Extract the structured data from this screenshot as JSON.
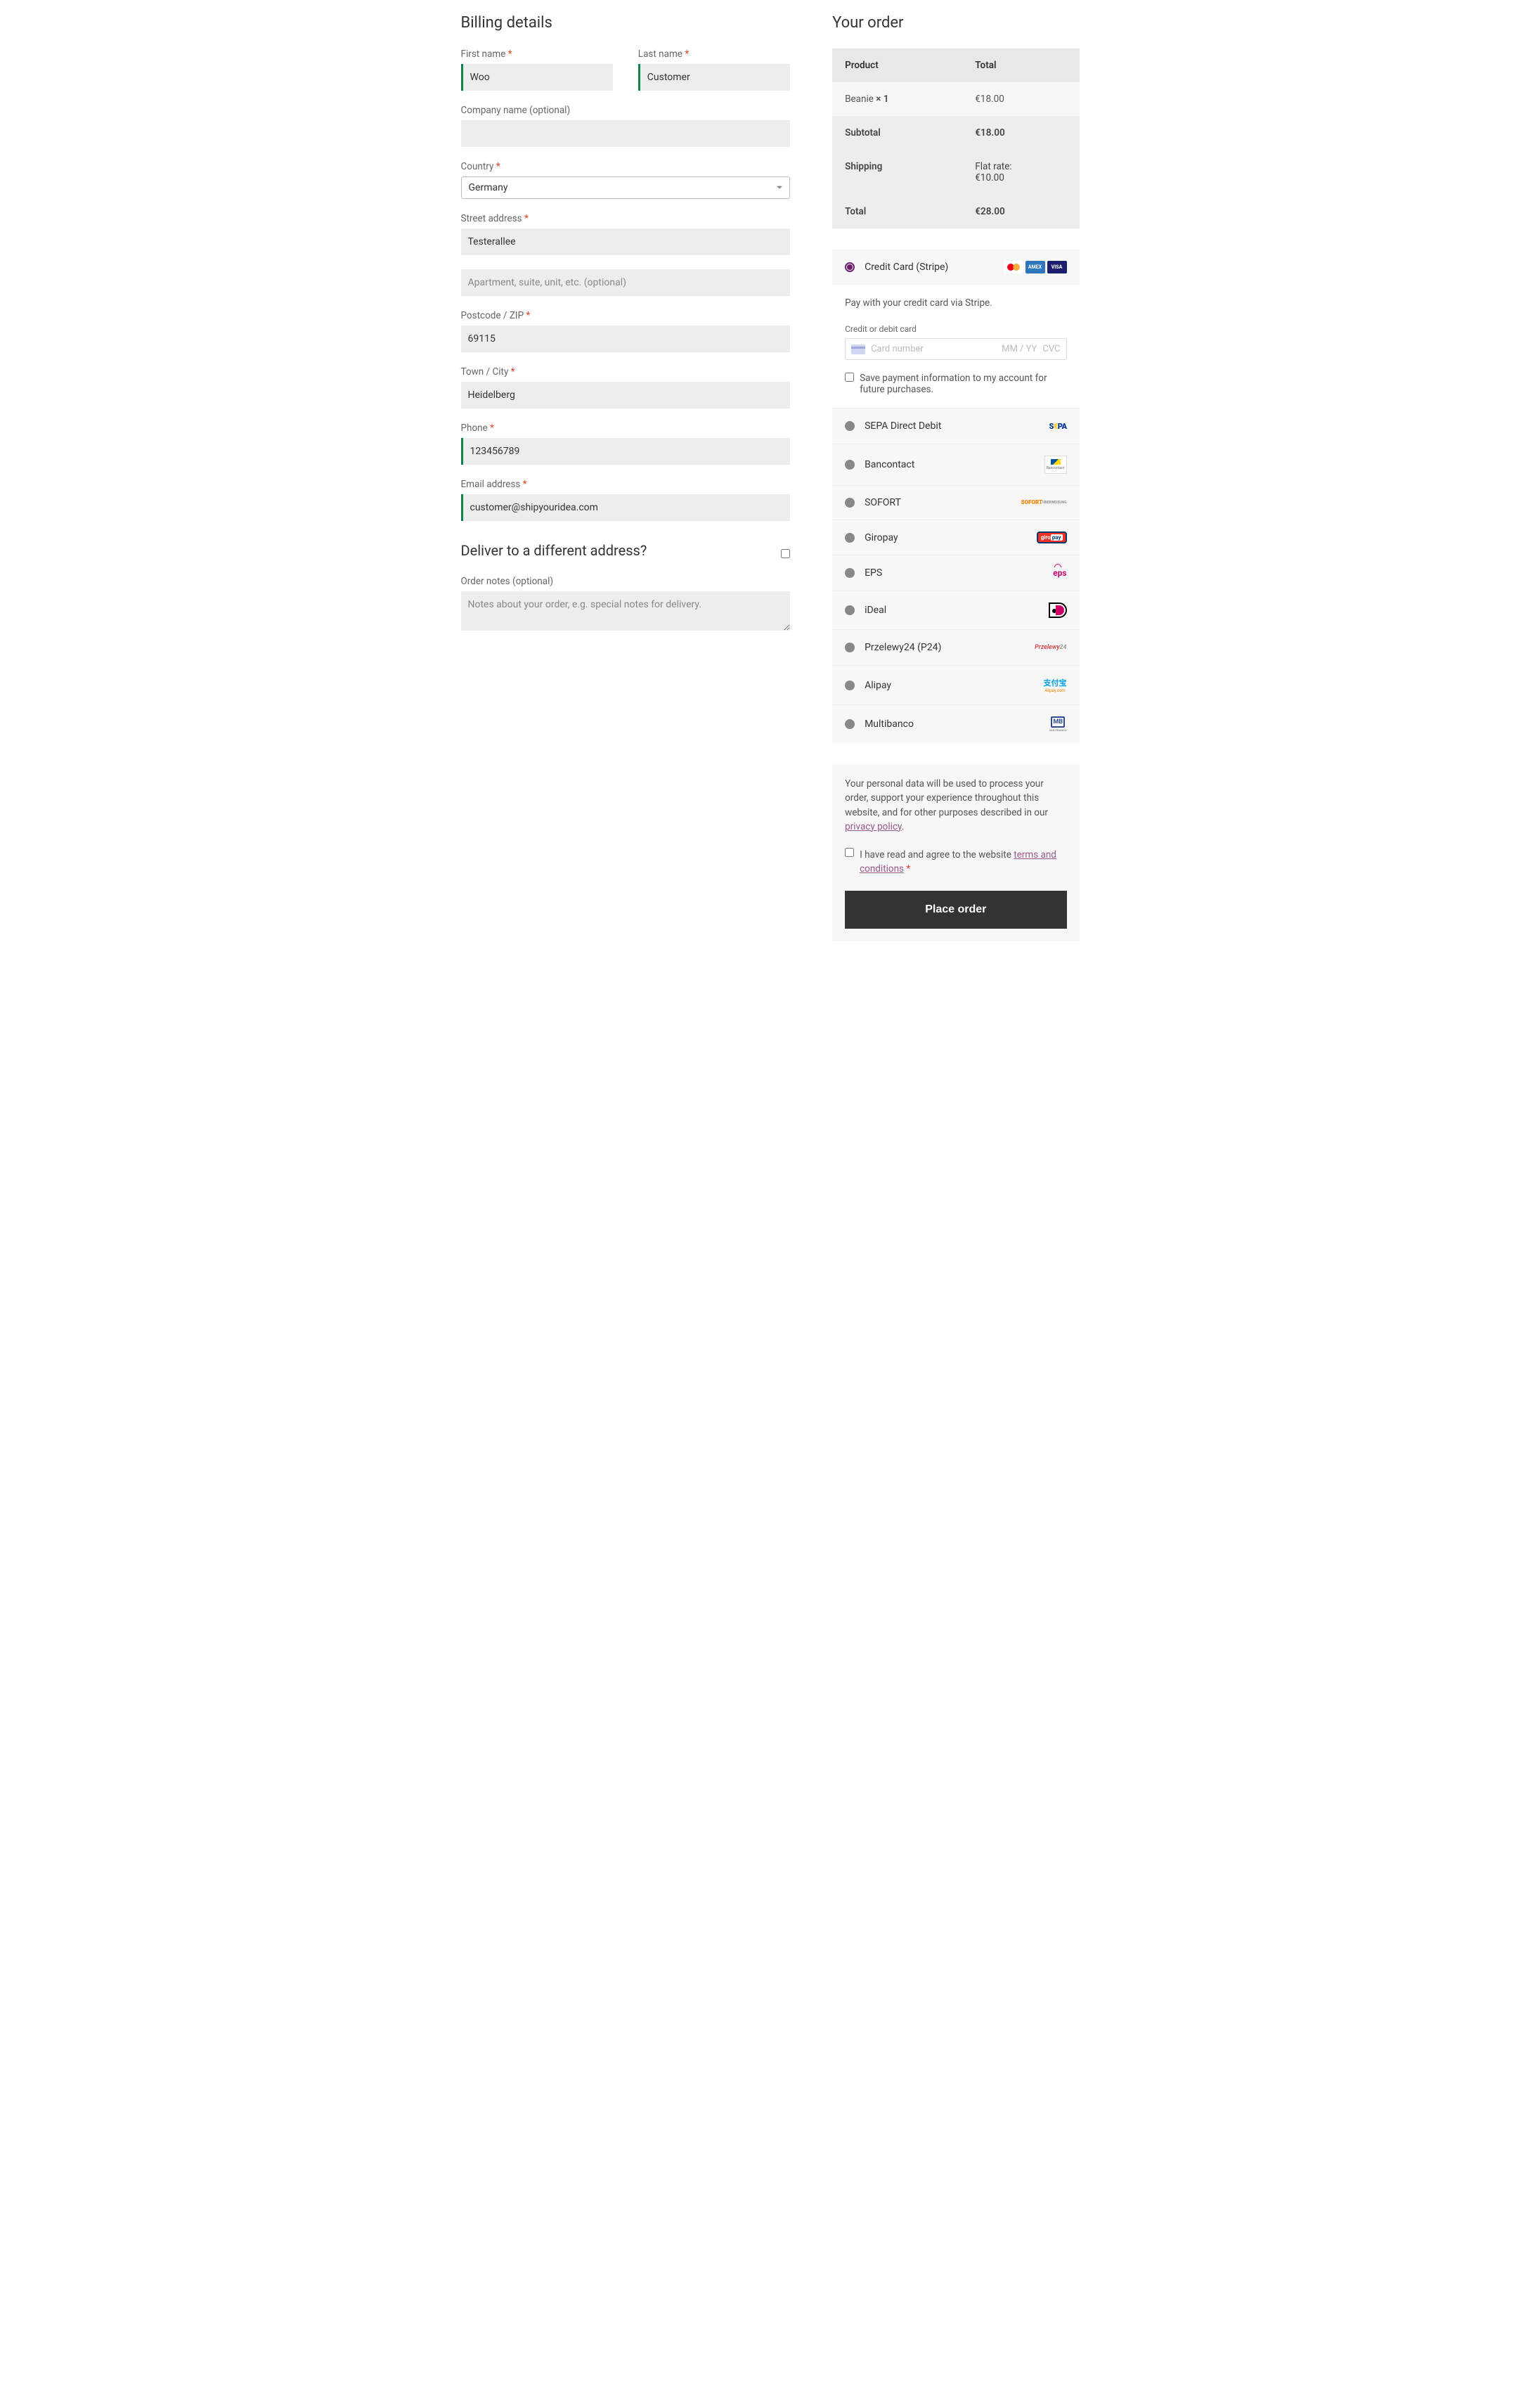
{
  "billing": {
    "heading": "Billing details",
    "first_name_label": "First name",
    "first_name_value": "Woo",
    "last_name_label": "Last name",
    "last_name_value": "Customer",
    "company_label": "Company name (optional)",
    "company_value": "",
    "country_label": "Country",
    "country_value": "Germany",
    "street_label": "Street address",
    "street_value": "Testerallee",
    "street2_placeholder": "Apartment, suite, unit, etc. (optional)",
    "postcode_label": "Postcode / ZIP",
    "postcode_value": "69115",
    "city_label": "Town / City",
    "city_value": "Heidelberg",
    "phone_label": "Phone",
    "phone_value": "123456789",
    "email_label": "Email address",
    "email_value": "customer@shipyouridea.com"
  },
  "shipping": {
    "deliver_heading": "Deliver to a different address?",
    "notes_label": "Order notes (optional)",
    "notes_placeholder": "Notes about your order, e.g. special notes for delivery."
  },
  "order": {
    "heading": "Your order",
    "col_product": "Product",
    "col_total": "Total",
    "item_name": "Beanie ",
    "item_qty": " × 1",
    "item_total": "€18.00",
    "subtotal_label": "Subtotal",
    "subtotal_value": "€18.00",
    "shipping_label": "Shipping",
    "shipping_value_line1": "Flat rate:",
    "shipping_value_line2": "€10.00",
    "total_label": "Total",
    "total_value": "€28.00"
  },
  "payment": {
    "stripe_label": "Credit Card (Stripe)",
    "stripe_desc": "Pay with your credit card via Stripe.",
    "card_field_label": "Credit or debit card",
    "card_placeholder": "Card number",
    "card_exp": "MM / YY",
    "card_cvc": "CVC",
    "save_card": "Save payment information to my account for future purchases.",
    "methods": {
      "sepa": "SEPA Direct Debit",
      "bancontact": "Bancontact",
      "sofort": "SOFORT",
      "giropay": "Giropay",
      "eps": "EPS",
      "ideal": "iDeal",
      "p24": "Przelewy24 (P24)",
      "alipay": "Alipay",
      "multibanco": "Multibanco"
    }
  },
  "footer": {
    "privacy_text_1": "Your personal data will be used to process your order, support your experience throughout this website, and for other purposes described in our ",
    "privacy_link": "privacy policy",
    "tc_text_1": "I have read and agree to the website ",
    "tc_link": "terms and conditions",
    "place_order": "Place order"
  },
  "asterisk": "*",
  "period": "."
}
